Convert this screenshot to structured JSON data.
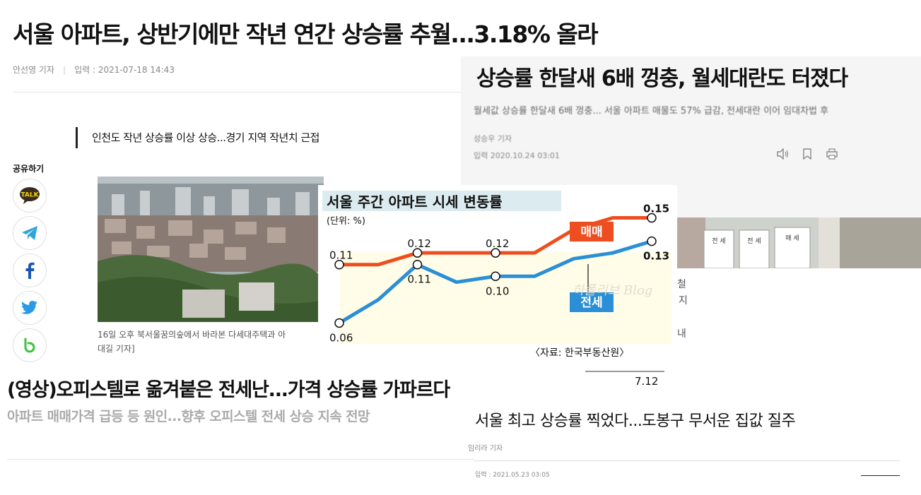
{
  "main_article": {
    "title": "서울 아파트, 상반기에만 작년 연간 상승률 추월...3.18% 올라",
    "reporter": "안선영 기자",
    "published": "입력 : 2021-07-18 14:43",
    "subtitle": "인천도 작년 상승률 이상 상승...경기 지역 작년치 근접",
    "share_label": "공유하기",
    "share_buttons": [
      "kakaotalk",
      "telegram",
      "facebook",
      "twitter",
      "band"
    ],
    "kakao_text": "TALK",
    "photo_caption": "16일 오후 북서울꿈의숲에서 바라본 다세대주택과 아",
    "photo_caption_line2": "대길 기자]"
  },
  "video_article": {
    "title": "(영상)오피스텔로 옮겨붙은 전세난...가격 상승률 가파르다",
    "subtitle": "아파트 매매가격 급등 등 원인...향후 오피스텔 전세 상승 지속 전망"
  },
  "overlay_article": {
    "title": "상승률 한달새 6배 껑충, 월세대란도 터졌다",
    "summary": "월세값 상승률 한달새 6배 껑충... 서울 아파트 매물도 57% 급감, 전세대란 이어 임대차법 후",
    "reporter": "성승우 기자",
    "published": "입력 2020.10.24 03:01",
    "icons": [
      "speaker-icon",
      "bookmark-icon",
      "print-icon"
    ],
    "sign_labels": [
      "전 세",
      "전 세",
      "매 세"
    ]
  },
  "edge_text": [
    "철",
    "지",
    "내"
  ],
  "chart_data": {
    "type": "line",
    "title": "서울 주간 아파트 시세 변동률",
    "unit_label": "(단위: %)",
    "source": "〈자료: 한국부동산원〉",
    "watermark": "하폴리브 Blog",
    "x_tick_label": "7.12",
    "series": [
      {
        "name": "매매",
        "color": "#ee4d1f",
        "values": [
          0.11,
          0.11,
          0.12,
          0.12,
          0.12,
          0.12,
          0.14,
          0.15,
          0.15
        ],
        "labels": {
          "0": "0.11",
          "2": "0.12",
          "4": "0.12",
          "8": "0.15"
        }
      },
      {
        "name": "전세",
        "color": "#2a8fd6",
        "values": [
          0.06,
          0.08,
          0.11,
          0.095,
          0.1,
          0.1,
          0.115,
          0.12,
          0.13
        ],
        "labels": {
          "0": "0.06",
          "2": "0.11",
          "4": "0.10",
          "8": "0.13"
        }
      }
    ],
    "ylim": [
      0.05,
      0.16
    ]
  },
  "br_article": {
    "title": "서울 최고 상승률 찍었다...도봉구 무서운 집값 질주",
    "reporter": "임리라 기자",
    "published": "입력 : 2021.05.23 03:05"
  }
}
